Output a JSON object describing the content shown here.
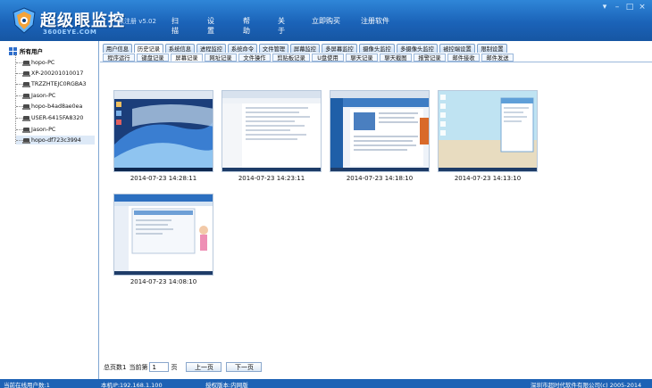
{
  "app": {
    "title": "超级眼监控",
    "subtitle": "3600EYE.COM",
    "reg_status": "未注册 v5.02"
  },
  "menu": [
    {
      "label": "扫 描"
    },
    {
      "label": "设 置"
    },
    {
      "label": "帮 助"
    },
    {
      "label": "关 于"
    },
    {
      "label": "立即购买"
    },
    {
      "label": "注册软件"
    }
  ],
  "window_controls": [
    "▾",
    "–",
    "□",
    "×"
  ],
  "sidebar": {
    "root_label": "所有用户",
    "items": [
      {
        "name": "hopo-PC"
      },
      {
        "name": "XP-200201010017"
      },
      {
        "name": "TRZZHTEJC0RGBA3"
      },
      {
        "name": "Jason-PC"
      },
      {
        "name": "hopo-b4ad8ae0ea"
      },
      {
        "name": "USER-6415FA8320"
      },
      {
        "name": "Jason-PC"
      },
      {
        "name": "hopo-df723c3994"
      }
    ]
  },
  "tabs_row1": [
    {
      "label": "用户信息"
    },
    {
      "label": "历史记录"
    },
    {
      "label": "系统信息"
    },
    {
      "label": "进程监控"
    },
    {
      "label": "系统命令"
    },
    {
      "label": "文件管理"
    },
    {
      "label": "屏幕监控"
    },
    {
      "label": "多屏幕监控"
    },
    {
      "label": "摄像头监控"
    },
    {
      "label": "多摄像头监控"
    },
    {
      "label": "被控端设置"
    },
    {
      "label": "限制设置"
    }
  ],
  "tabs_row2": [
    {
      "label": "程序运行"
    },
    {
      "label": "键盘记录"
    },
    {
      "label": "屏幕记录"
    },
    {
      "label": "网址记录"
    },
    {
      "label": "文件操作"
    },
    {
      "label": "剪贴板记录"
    },
    {
      "label": "U盘使用"
    },
    {
      "label": "聊天记录"
    },
    {
      "label": "聊天截图"
    },
    {
      "label": "报警记录"
    },
    {
      "label": "邮件接收"
    },
    {
      "label": "邮件发送"
    }
  ],
  "screenshots": [
    {
      "time": "2014-07-23 14:28:11"
    },
    {
      "time": "2014-07-23 14:23:11"
    },
    {
      "time": "2014-07-23 14:18:10"
    },
    {
      "time": "2014-07-23 14:13:10"
    },
    {
      "time": "2014-07-23 14:08:10"
    }
  ],
  "pager": {
    "total_label": "总页数1",
    "current_label": "当前第",
    "current_value": "1",
    "page_unit": "页",
    "prev": "上一页",
    "next": "下一页"
  },
  "status": {
    "online": "当前在线用户数:1",
    "ip": "本机IP:192.168.1.100",
    "version": "授权版本:内网版",
    "copyright": "深圳市超时代软件有限公司(c) 2005-2014"
  },
  "colors": {
    "titlebar": "#1b63b8",
    "statusbar": "#1d62b5",
    "tab_border": "#7ea2cc"
  }
}
